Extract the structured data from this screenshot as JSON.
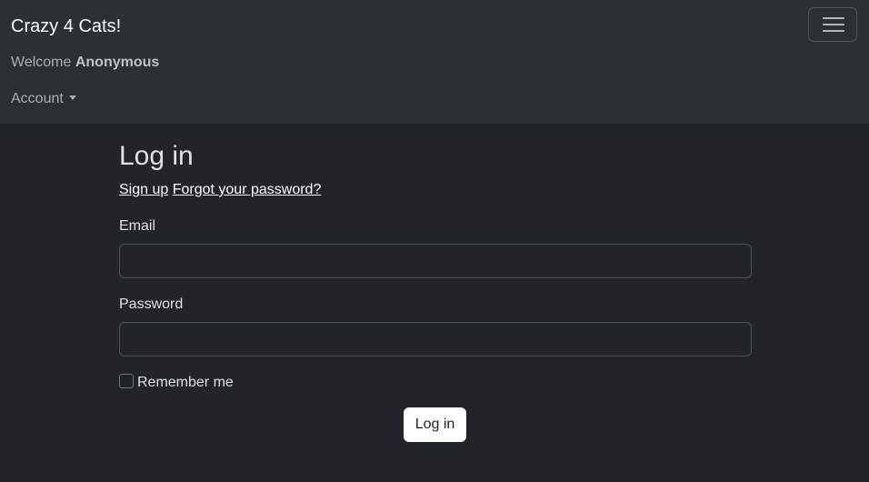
{
  "navbar": {
    "brand": "Crazy 4 Cats!",
    "welcome_prefix": "Welcome ",
    "welcome_user": "Anonymous",
    "account_label": "Account"
  },
  "form": {
    "title": "Log in",
    "signup_link": "Sign up",
    "forgot_link": "Forgot your password?",
    "email_label": "Email",
    "email_value": "",
    "password_label": "Password",
    "password_value": "",
    "remember_label": "Remember me",
    "remember_checked": false,
    "submit_label": "Log in"
  },
  "colors": {
    "background": "#212529",
    "navbar_bg": "#2b3035",
    "button_bg": "#ffffff"
  }
}
